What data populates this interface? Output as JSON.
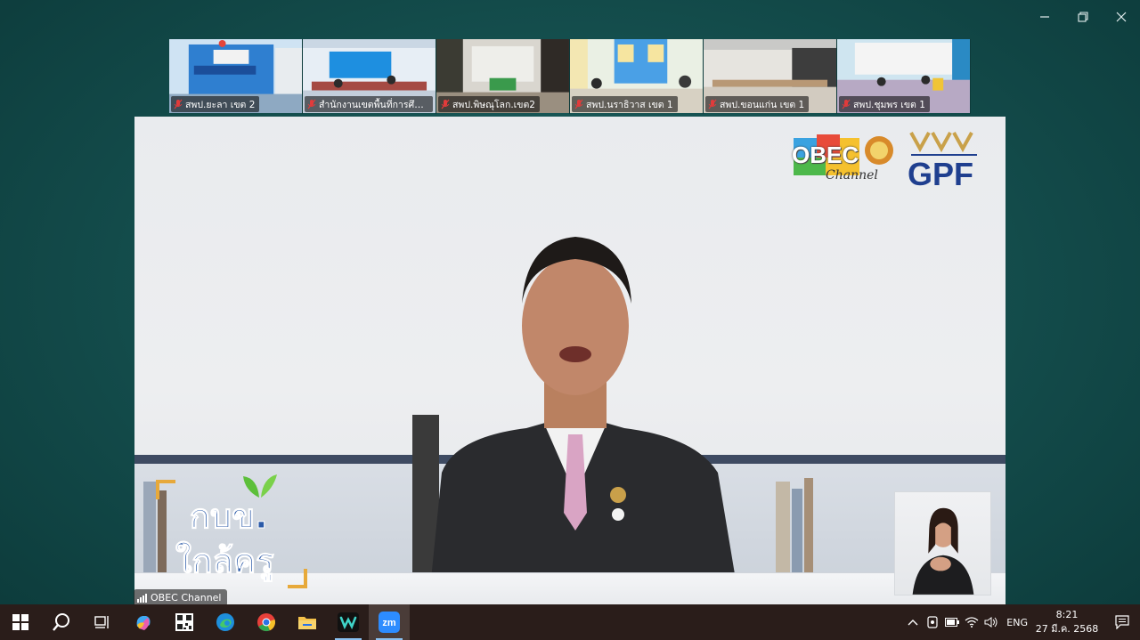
{
  "window": {
    "controls": [
      "minimize",
      "restore",
      "close"
    ]
  },
  "gallery": [
    {
      "label": "สพป.ยะลา เขต 2"
    },
    {
      "label": "สำนักงานเขตพื้นที่การศึก..."
    },
    {
      "label": "สพป.พิษณุโลก.เขต2"
    },
    {
      "label": "สพป.นราธิวาส เขต 1"
    },
    {
      "label": "สพป.ขอนแก่น เขต 1"
    },
    {
      "label": "สพป.ชุมพร เขต 1"
    }
  ],
  "main_video": {
    "logo_obec": "OBEC",
    "logo_obec_sub": "Channel",
    "logo_gpf": "GPF",
    "show_title_line1": "กบข.",
    "show_title_line2": "ใกล้ครู",
    "speaker_name": "OBEC Channel"
  },
  "taskbar": {
    "apps": [
      "start-icon",
      "search-icon",
      "task-view-icon",
      "copilot-icon",
      "qr-app-icon",
      "edge-icon",
      "chrome-icon",
      "file-explorer-icon",
      "webex-icon",
      "zoom-icon"
    ],
    "active_app": "zoom-icon",
    "language": "ENG",
    "time": "8:21",
    "date": "27 มี.ค. 2568"
  },
  "colors": {
    "accent_blue": "#2b5aa8",
    "gold": "#e7a93a",
    "teal_bg": "#15504f",
    "taskbar": "#2a1d1a"
  }
}
